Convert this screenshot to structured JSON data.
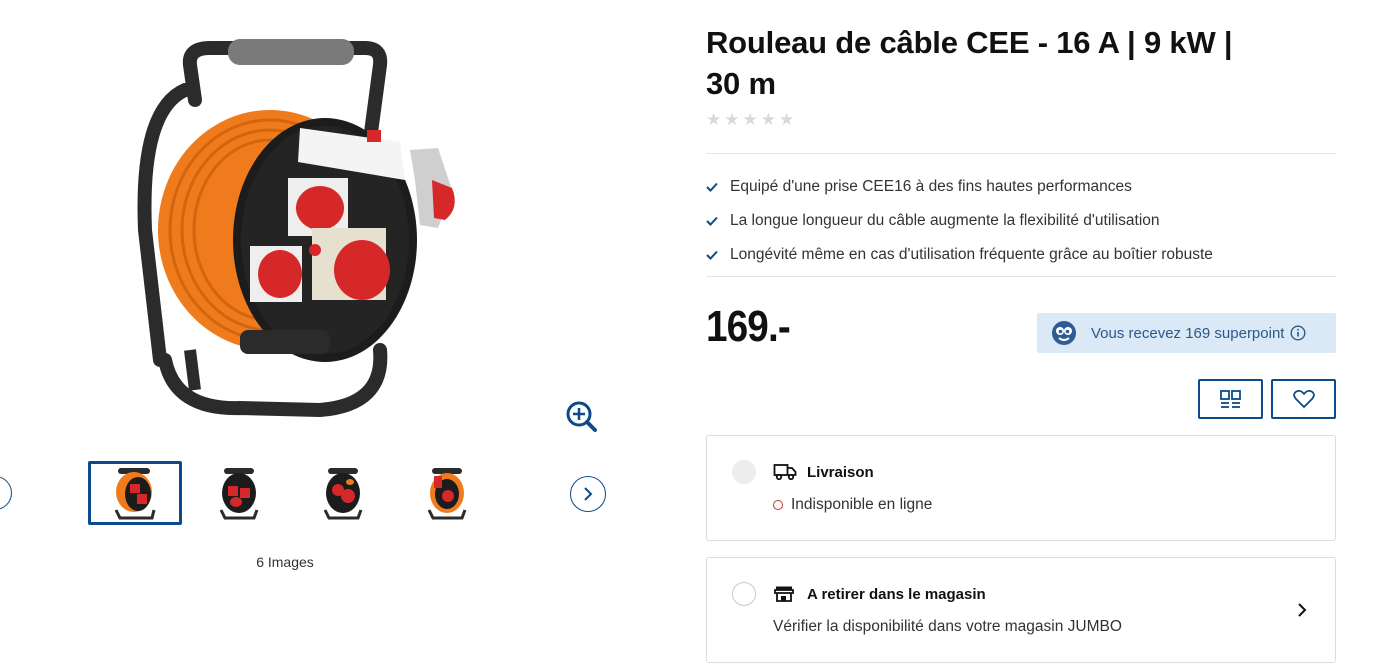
{
  "product": {
    "title_line1": "Rouleau de câble CEE - 16 A | 9 kW |",
    "title_line2": "30 m",
    "rating_stars": 0,
    "rating_max": 5
  },
  "features": [
    "Equipé d'une prise CEE16 à des fins hautes performances",
    "La longue longueur du câble augmente la flexibilité d'utilisation",
    "Longévité même en cas d'utilisation fréquente grâce au boîtier robuste"
  ],
  "price": "169.-",
  "superpoints": {
    "label": "Vous recevez 169 superpoint"
  },
  "gallery": {
    "image_count_label": "6 Images"
  },
  "delivery": {
    "title": "Livraison",
    "status": "Indisponible en ligne"
  },
  "pickup": {
    "title": "A retirer dans le magasin",
    "subtitle": "Vérifier la disponibilité dans votre magasin JUMBO"
  },
  "icons": {
    "zoom": "zoom-in-icon",
    "compare": "compare-icon",
    "wishlist": "heart-icon",
    "truck": "truck-icon",
    "store": "store-icon",
    "info": "info-icon",
    "check": "check-icon"
  },
  "colors": {
    "brand_blue": "#0b4a8b",
    "superpoint_bg": "#dbe9f6",
    "unavailable": "#c0392b",
    "cable_orange": "#f07b1d"
  }
}
